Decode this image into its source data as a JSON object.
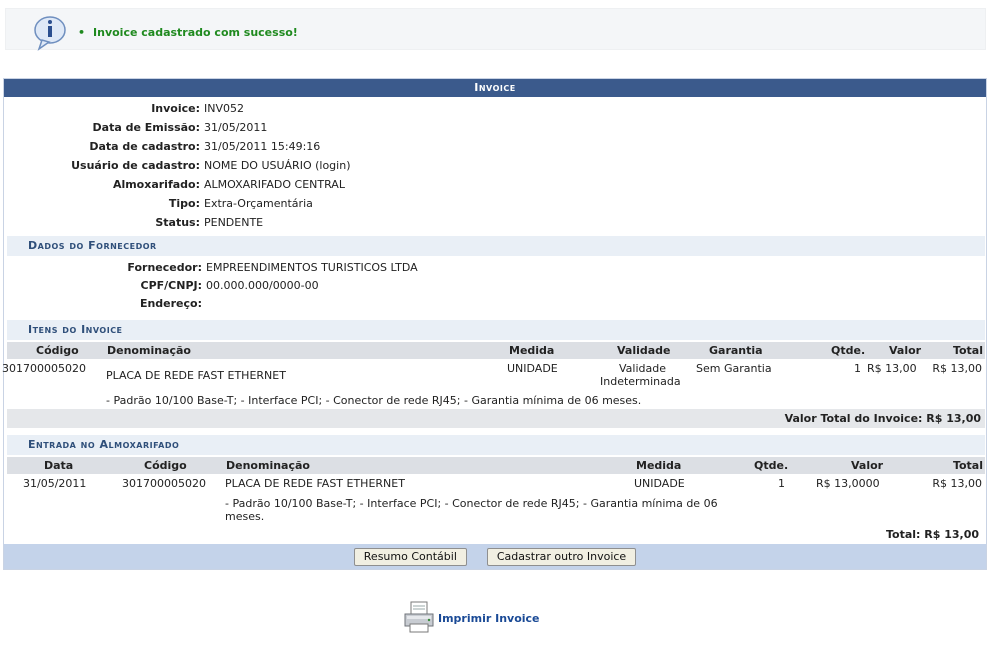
{
  "message": {
    "bullet": "•",
    "text": "Invoice cadastrado com sucesso!"
  },
  "panel": {
    "caption": "Invoice",
    "fields": [
      {
        "label": "Invoice:",
        "value": "INV052"
      },
      {
        "label": "Data de Emissão:",
        "value": "31/05/2011"
      },
      {
        "label": "Data de cadastro:",
        "value": "31/05/2011 15:49:16"
      },
      {
        "label": "Usuário de cadastro:",
        "value": "NOME DO USUÁRIO (login)"
      },
      {
        "label": "Almoxarifado:",
        "value": "ALMOXARIFADO CENTRAL"
      },
      {
        "label": "Tipo:",
        "value": "Extra-Orçamentária"
      },
      {
        "label": "Status:",
        "value": "PENDENTE"
      }
    ],
    "supplier": {
      "heading": "Dados do Fornecedor",
      "fields": [
        {
          "label": "Fornecedor:",
          "value": "EMPREENDIMENTOS TURISTICOS LTDA"
        },
        {
          "label": "CPF/CNPJ:",
          "value": "00.000.000/0000-00"
        },
        {
          "label": "Endereço:",
          "value": ""
        }
      ]
    },
    "items": {
      "heading": "Itens do Invoice",
      "headers": {
        "codigo": "Código",
        "denominacao": "Denominação",
        "medida": "Medida",
        "validade": "Validade",
        "garantia": "Garantia",
        "qtde": "Qtde.",
        "valor": "Valor",
        "total": "Total"
      },
      "row": {
        "codigo": "301700005020",
        "denominacao": "PLACA DE REDE FAST ETHERNET",
        "medida": "UNIDADE",
        "validade_1": "Validade",
        "validade_2": "Indeterminada",
        "garantia": "Sem Garantia",
        "qtde": "1",
        "valor": "R$ 13,00",
        "total": "R$ 13,00",
        "description": "- Padrão 10/100 Base-T; - Interface PCI; - Conector de rede RJ45; - Garantia mínima de 06 meses."
      },
      "total_label": "Valor Total do Invoice: R$ 13,00"
    },
    "entry": {
      "heading": "Entrada no Almoxarifado",
      "headers": {
        "data": "Data",
        "codigo": "Código",
        "denominacao": "Denominação",
        "medida": "Medida",
        "qtde": "Qtde.",
        "valor": "Valor",
        "total": "Total"
      },
      "row": {
        "data": "31/05/2011",
        "codigo": "301700005020",
        "denominacao": "PLACA DE REDE FAST ETHERNET",
        "medida": "UNIDADE",
        "qtde": "1",
        "valor": "R$ 13,0000",
        "total": "R$ 13,00",
        "description_1": "- Padrão 10/100 Base-T; - Interface PCI; - Conector de rede RJ45; - Garantia mínima de 06",
        "description_2": "meses."
      },
      "total_label": "Total: R$ 13,00"
    },
    "buttons": {
      "resumo": "Resumo Contábil",
      "cadastrar": "Cadastrar outro Invoice"
    }
  },
  "print": {
    "label": "Imprimir Invoice",
    "icon": "printer-icon"
  },
  "colors": {
    "caption_bg": "#3b5a8c",
    "success_text": "#1f8a1f",
    "footer_bg": "#c4d3ea",
    "link": "#1a4a96"
  }
}
